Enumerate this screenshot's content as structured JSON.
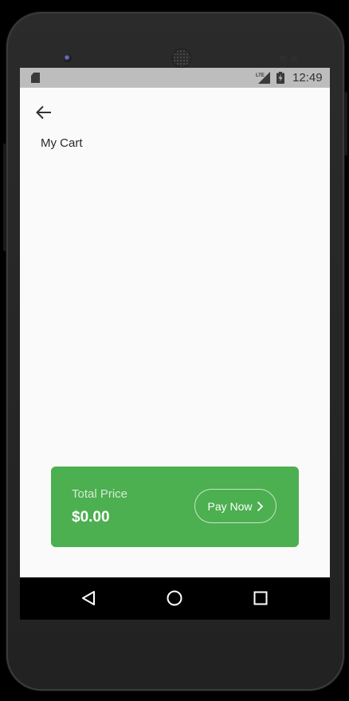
{
  "status_bar": {
    "time": "12:49",
    "network_label": "LTE",
    "icons": [
      "sd-card-icon",
      "lte-signal-icon",
      "battery-charging-icon"
    ]
  },
  "toolbar": {
    "back_icon": "arrow-left-icon"
  },
  "page": {
    "title": "My Cart"
  },
  "summary": {
    "total_label": "Total Price",
    "total_value": "$0.00",
    "pay_button_label": "Pay Now",
    "pay_button_icon": "chevron-right-icon"
  },
  "nav_bar": {
    "icons": [
      "back-triangle-icon",
      "home-circle-icon",
      "recents-square-icon"
    ]
  },
  "colors": {
    "accent": "#4caf50",
    "screen_background": "#fafafa",
    "status_bar": "#bdbdbd",
    "nav_bar": "#000000"
  }
}
